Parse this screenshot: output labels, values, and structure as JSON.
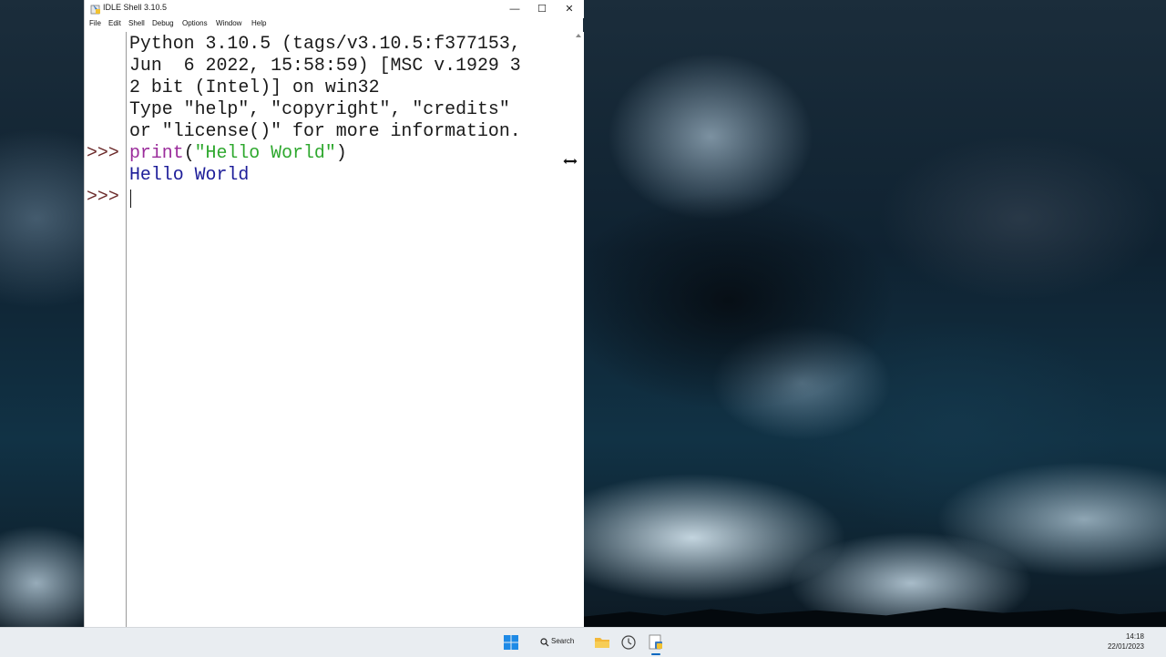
{
  "window": {
    "title": "IDLE Shell 3.10.5",
    "controls": {
      "minimize": "—",
      "maximize": "☐",
      "close": "✕"
    }
  },
  "menu": [
    "File",
    "Edit",
    "Shell",
    "Debug",
    "Options",
    "Window",
    "Help"
  ],
  "shell": {
    "banner": [
      "Python 3.10.5 (tags/v3.10.5:f377153,",
      "Jun  6 2022, 15:58:59) [MSC v.1929 3",
      "2 bit (Intel)] on win32",
      "Type \"help\", \"copyright\", \"credits\"",
      "or \"license()\" for more information."
    ],
    "prompt": ">>>",
    "command": {
      "func": "print",
      "open": "(",
      "arg": "\"Hello World\"",
      "close": ")"
    },
    "output": "Hello World",
    "input_value": ""
  },
  "taskbar": {
    "search_label": "Search",
    "time": "14:18",
    "date": "22/01/2023",
    "icons": [
      "windows-start-icon",
      "search-icon",
      "file-explorer-icon",
      "clock-app-icon",
      "idle-python-icon"
    ]
  },
  "colors": {
    "prompt": "#6b2a2a",
    "builtin": "#9b2c9b",
    "string": "#2ea82e",
    "stdout": "#1d1d99",
    "accent": "#0067c0"
  }
}
